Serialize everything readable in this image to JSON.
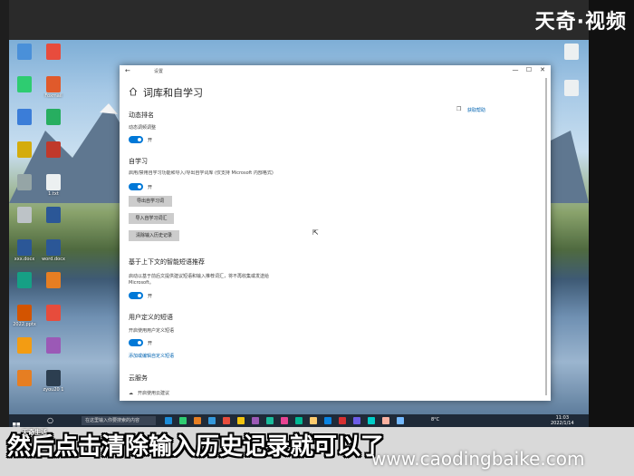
{
  "brand": {
    "top_logo": "天奇·视频",
    "small_logo": "天奇生活"
  },
  "desktop": {
    "icons_left": [
      {
        "label": "",
        "color": "#4a90d9"
      },
      {
        "label": "",
        "color": "#e84c3d"
      },
      {
        "label": "",
        "color": "#2ecc71"
      },
      {
        "label": "Foxmail",
        "color": "#e05a2b"
      },
      {
        "label": "",
        "color": "#3b7dd8"
      },
      {
        "label": "",
        "color": "#27ae60"
      },
      {
        "label": "",
        "color": "#d4ac0d"
      },
      {
        "label": "",
        "color": "#c0392b"
      },
      {
        "label": "",
        "color": "#95a5a6"
      },
      {
        "label": "1.txt",
        "color": "#ecf0f1"
      },
      {
        "label": "",
        "color": "#bdc3c7"
      },
      {
        "label": "",
        "color": "#2b5797"
      },
      {
        "label": "xxx.docx",
        "color": "#2b5797"
      },
      {
        "label": "word.docx",
        "color": "#2b5797"
      },
      {
        "label": "",
        "color": "#16a085"
      },
      {
        "label": "",
        "color": "#e67e22"
      },
      {
        "label": "2022.pptx",
        "color": "#d35400"
      },
      {
        "label": "",
        "color": "#e74c3c"
      },
      {
        "label": "",
        "color": "#f39c12"
      },
      {
        "label": "",
        "color": "#9b59b6"
      },
      {
        "label": "",
        "color": "#e67e22"
      },
      {
        "label": "zyou20 1",
        "color": "#2c3e50"
      }
    ],
    "icons_right": [
      {
        "label": "",
        "color": "#ecf0f1"
      },
      {
        "label": "",
        "color": "#ecf0f1"
      }
    ]
  },
  "window": {
    "titlebar_title": "设置",
    "minimize": "—",
    "maximize": "☐",
    "close": "✕",
    "back": "←",
    "page_title": "词库和自学习",
    "help_link": "获取帮助",
    "sections": {
      "dynamic_rank": {
        "heading": "动态排名",
        "desc": "动态调频调整",
        "toggle_state": "开"
      },
      "self_learning": {
        "heading": "自学习",
        "desc": "启用/禁用自学习功能和导入/导出自学词库 (仅支持 Microsoft 内部格式)",
        "toggle_state": "开",
        "buttons": [
          "导出自学习词",
          "导入自学习词汇",
          "清除输入历史记录"
        ]
      },
      "context": {
        "heading": "基于上下文的智能短语推荐",
        "desc": "启动以基于前后文提供建议短语和输入推荐词汇，将不再收集或发送给 Microsoft。",
        "toggle_state": "开"
      },
      "user_phrases": {
        "heading": "用户定义的短语",
        "desc": "开启使用用户定义短语",
        "toggle_state": "开",
        "link": "添加或编辑自定义短语"
      },
      "cloud": {
        "heading": "云服务",
        "desc": "开启使用云建议"
      }
    }
  },
  "taskbar": {
    "search_placeholder": "在这里输入你要搜索的内容",
    "weather": "8°C",
    "time": "11:03",
    "date": "2022/1/14",
    "app_colors": [
      "#1b8cd8",
      "#2ecc71",
      "#e67e22",
      "#3498db",
      "#e74c3c",
      "#f1c40f",
      "#9b59b6",
      "#1abc9c",
      "#e84393",
      "#00b894",
      "#fdcb6e",
      "#0984e3",
      "#d63031",
      "#6c5ce7",
      "#00cec9",
      "#fab1a0",
      "#74b9ff"
    ]
  },
  "subtitle": "然后点击清除输入历史记录就可以了",
  "watermark": "www.caodingbaike.com"
}
